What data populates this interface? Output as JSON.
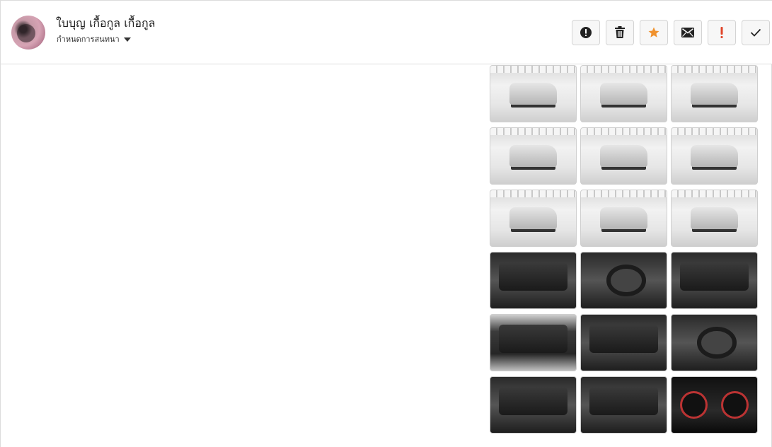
{
  "contact": {
    "name": "ใบบุญ เกื้อกูล เกื้อกูล",
    "assign_label": "กำหนดการสนทนา"
  },
  "actions": [
    {
      "name": "report-button",
      "icon": "exclamation-circle-icon"
    },
    {
      "name": "delete-button",
      "icon": "trash-icon"
    },
    {
      "name": "star-button",
      "icon": "star-icon",
      "color": "#f0922e"
    },
    {
      "name": "mail-button",
      "icon": "envelope-icon"
    },
    {
      "name": "important-button",
      "icon": "exclamation-icon",
      "color": "#e0452a"
    },
    {
      "name": "done-button",
      "icon": "check-icon"
    }
  ],
  "gallery": [
    {
      "kind": "exterior",
      "subject": "front-left"
    },
    {
      "kind": "exterior",
      "subject": "front"
    },
    {
      "kind": "exterior",
      "subject": "rear-right"
    },
    {
      "kind": "exterior",
      "subject": "rear-left"
    },
    {
      "kind": "exterior",
      "subject": "side-left"
    },
    {
      "kind": "exterior",
      "subject": "rear"
    },
    {
      "kind": "exterior",
      "subject": "side-left-wide"
    },
    {
      "kind": "exterior",
      "subject": "front-right"
    },
    {
      "kind": "exterior",
      "subject": "wheel-closeup"
    },
    {
      "kind": "interior",
      "subject": "door-panel"
    },
    {
      "kind": "interior",
      "subject": "steering-dashboard"
    },
    {
      "kind": "interior",
      "subject": "gear-shift"
    },
    {
      "kind": "engine",
      "subject": "engine-bay"
    },
    {
      "kind": "interior",
      "subject": "cabin-front"
    },
    {
      "kind": "interior",
      "subject": "driver-seat"
    },
    {
      "kind": "interior",
      "subject": "center-console"
    },
    {
      "kind": "interior",
      "subject": "rear-seat"
    },
    {
      "kind": "dark",
      "subject": "instrument-cluster"
    }
  ]
}
